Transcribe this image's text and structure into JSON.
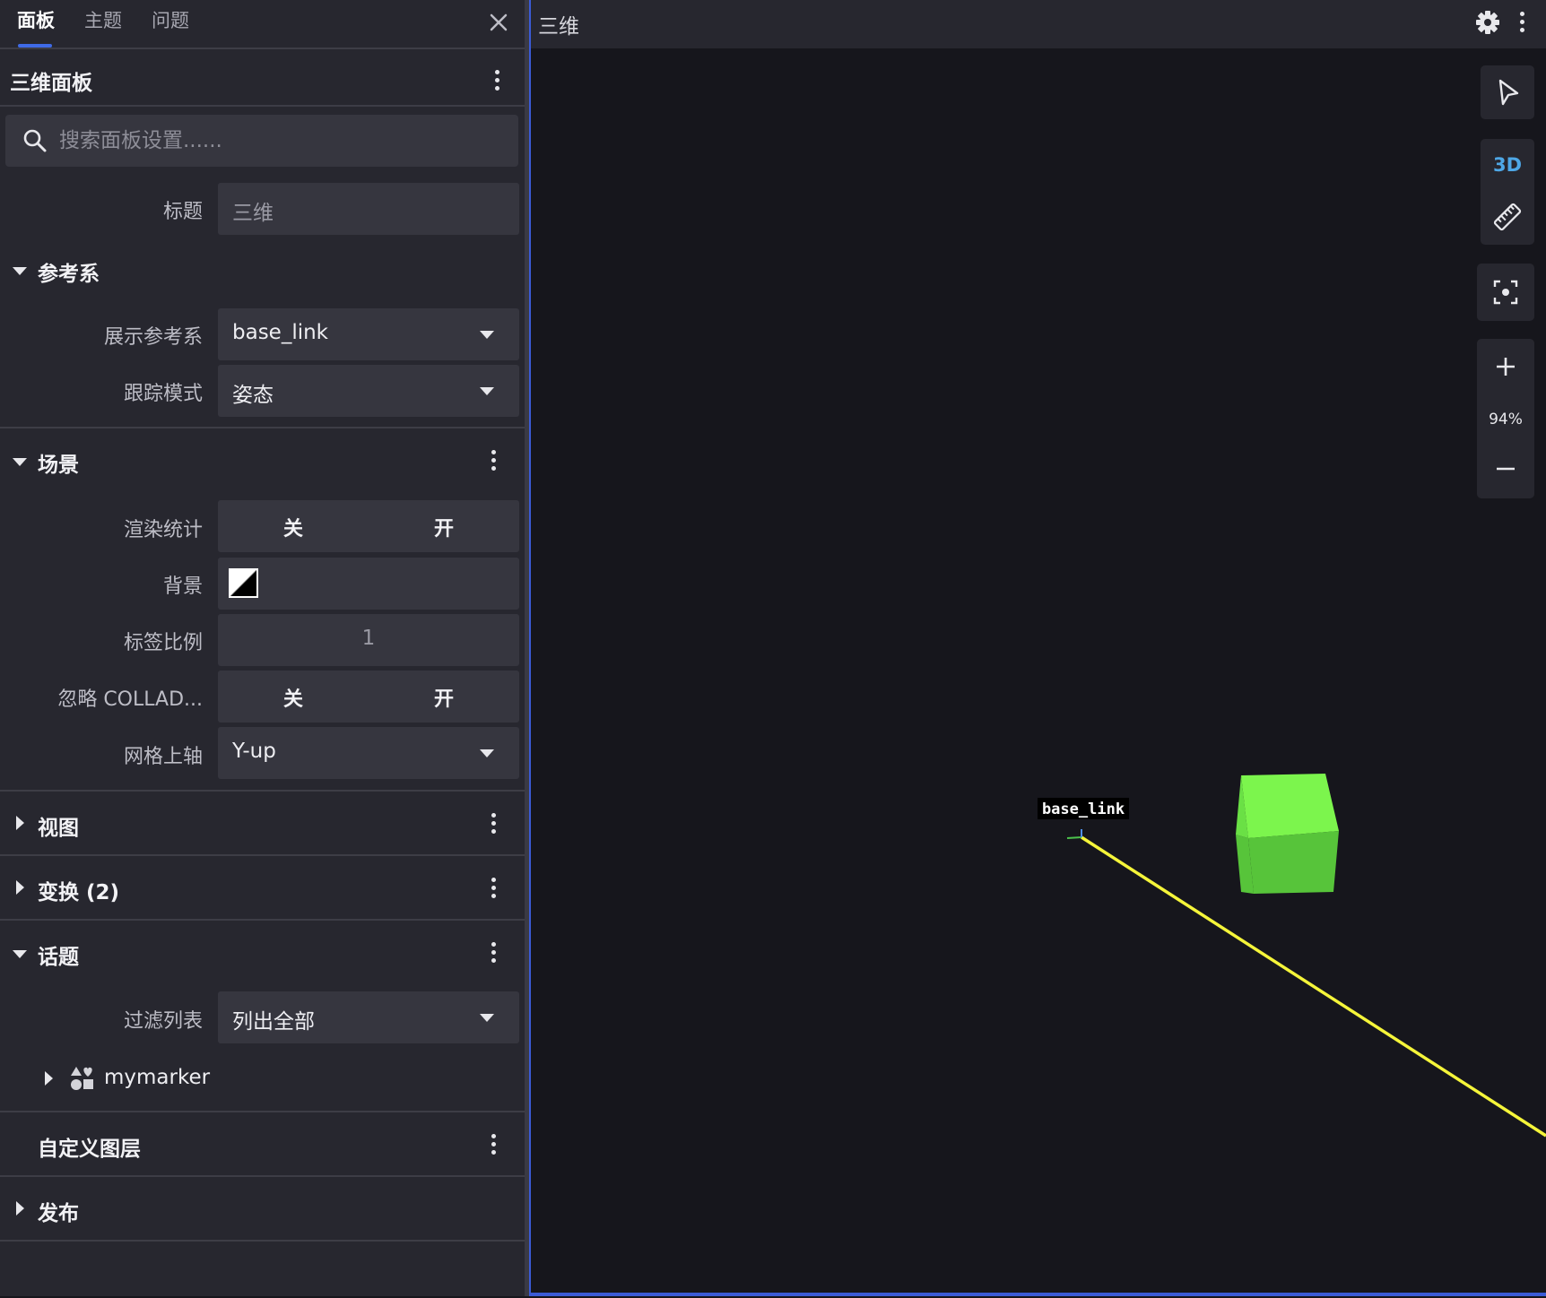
{
  "sidebar": {
    "tabs": [
      {
        "label": "面板",
        "active": true
      },
      {
        "label": "主题",
        "active": false
      },
      {
        "label": "问题",
        "active": false
      }
    ],
    "panel_title": "三维面板",
    "search": {
      "placeholder": "搜索面板设置......"
    },
    "general": {
      "title_label": "标题",
      "title_value": "三维"
    },
    "frame": {
      "section_title": "参考系",
      "display_frame_label": "展示参考系",
      "display_frame_value": "base_link",
      "follow_mode_label": "跟踪模式",
      "follow_mode_value": "姿态"
    },
    "scene": {
      "section_title": "场景",
      "render_stats_label": "渲染统计",
      "off_label": "关",
      "on_label": "开",
      "background_label": "背景",
      "label_scale_label": "标签比例",
      "label_scale_value": "1",
      "ignore_collada_label": "忽略 COLLAD...",
      "mesh_up_axis_label": "网格上轴",
      "mesh_up_axis_value": "Y-up"
    },
    "view": {
      "section_title": "视图"
    },
    "transforms": {
      "section_title": "变换 (2)"
    },
    "topics": {
      "section_title": "话题",
      "filter_label": "过滤列表",
      "filter_value": "列出全部",
      "items": [
        {
          "name": "mymarker"
        }
      ]
    },
    "custom_layers": {
      "section_title": "自定义图层"
    },
    "publish": {
      "section_title": "发布"
    }
  },
  "main": {
    "title": "三维",
    "toolbar": {
      "mode_3d_label": "3D",
      "zoom_level": "94%"
    },
    "scene": {
      "frame_label": "base_link"
    }
  },
  "colors": {
    "accent": "#3f6ae6",
    "cube_light": "#7cf54d",
    "cube_front": "#57c43a",
    "line": "#f5f53a",
    "mode_3d": "#4ea7e6"
  },
  "icons": [
    "close-icon",
    "search-icon",
    "kebab-menu-icon",
    "gear-icon",
    "select-pointer-icon",
    "ruler-icon",
    "focus-icon",
    "zoom-in-icon",
    "zoom-out-icon",
    "marker-shapes-icon"
  ]
}
